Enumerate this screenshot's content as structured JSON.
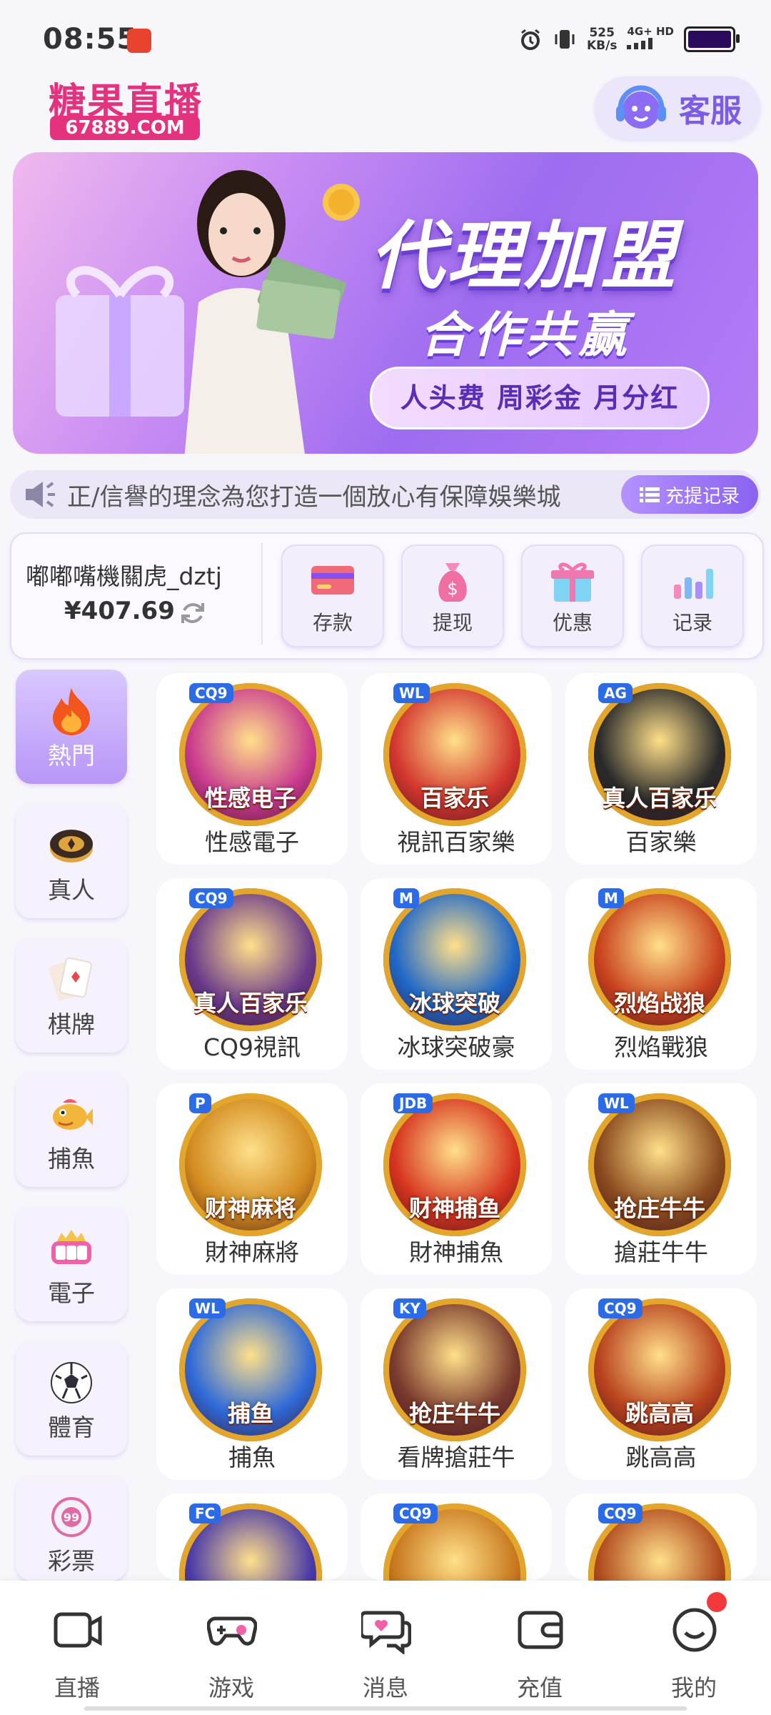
{
  "status_bar": {
    "time": "08:55",
    "speed_value": "525",
    "speed_unit": "KB/s",
    "network_top": "4G+ HD",
    "battery_level": 0.92
  },
  "header": {
    "logo_text": "糖果直播",
    "logo_domain": "67889.COM",
    "customer_service_label": "客服"
  },
  "banner": {
    "title": "代理加盟",
    "subtitle": "合作共赢",
    "tagline": "人头费 周彩金 月分红",
    "slide_count": 4,
    "active_slide": 1
  },
  "notice": {
    "text": "正/信譽的理念為您打造一個放心有保障娛樂城",
    "records_label": "充提记录"
  },
  "wallet": {
    "username": "嘟嘟嘴機關虎_dztj",
    "balance": "¥407.69",
    "actions": [
      {
        "label": "存款",
        "icon": "card-icon"
      },
      {
        "label": "提现",
        "icon": "money-bag-icon"
      },
      {
        "label": "优惠",
        "icon": "gift-icon"
      },
      {
        "label": "记录",
        "icon": "bar-chart-icon"
      }
    ]
  },
  "categories": [
    {
      "label": "熱門",
      "icon": "fire-icon",
      "active": true
    },
    {
      "label": "真人",
      "icon": "chip-icon",
      "active": false
    },
    {
      "label": "棋牌",
      "icon": "card-icon",
      "active": false
    },
    {
      "label": "捕魚",
      "icon": "fish-icon",
      "active": false
    },
    {
      "label": "電子",
      "icon": "slot-icon",
      "active": false
    },
    {
      "label": "體育",
      "icon": "soccer-ball-icon",
      "active": false
    },
    {
      "label": "彩票",
      "icon": "lottery-ball-icon",
      "active": false
    }
  ],
  "games": [
    {
      "name": "性感電子",
      "provider": "CQ9",
      "art_title": "性感电子",
      "color": "#c93a8f"
    },
    {
      "name": "視訊百家樂",
      "provider": "WL",
      "art_title": "百家乐",
      "color": "#d2362e"
    },
    {
      "name": "百家樂",
      "provider": "AG",
      "art_title": "真人百家乐",
      "color": "#2a2a2a"
    },
    {
      "name": "CQ9視訊",
      "provider": "CQ9",
      "art_title": "真人百家乐",
      "color": "#6a3a8a"
    },
    {
      "name": "冰球突破豪",
      "provider": "M",
      "art_title": "冰球突破",
      "color": "#1e67c8"
    },
    {
      "name": "烈焰戰狼",
      "provider": "M",
      "art_title": "烈焰战狼",
      "color": "#c8421e"
    },
    {
      "name": "財神麻將",
      "provider": "P",
      "art_title": "财神麻将",
      "color": "#d28a1e"
    },
    {
      "name": "財神捕魚",
      "provider": "JDB",
      "art_title": "财神捕鱼",
      "color": "#d6341f"
    },
    {
      "name": "搶莊牛牛",
      "provider": "WL",
      "art_title": "抢庄牛牛",
      "color": "#8a4a1e"
    },
    {
      "name": "捕魚",
      "provider": "WL",
      "art_title": "捕鱼",
      "color": "#2f6ad8"
    },
    {
      "name": "看牌搶莊牛",
      "provider": "KY",
      "art_title": "抢庄牛牛",
      "color": "#7a3a2e"
    },
    {
      "name": "跳高高",
      "provider": "CQ9",
      "art_title": "跳高高",
      "color": "#b8421e"
    },
    {
      "name": "",
      "provider": "FC",
      "art_title": "",
      "color": "#4a3aa8"
    },
    {
      "name": "",
      "provider": "CQ9",
      "art_title": "",
      "color": "#c8781e"
    },
    {
      "name": "",
      "provider": "CQ9",
      "art_title": "",
      "color": "#b04a1e"
    }
  ],
  "bottom_nav": [
    {
      "label": "直播",
      "icon": "camera-icon"
    },
    {
      "label": "游戏",
      "icon": "gamepad-icon"
    },
    {
      "label": "消息",
      "icon": "chat-icon"
    },
    {
      "label": "充值",
      "icon": "wallet-icon"
    },
    {
      "label": "我的",
      "icon": "profile-icon"
    }
  ],
  "colors": {
    "accent": "#8a62f0",
    "brand": "#e4327e",
    "background": "#f7f6fb"
  }
}
